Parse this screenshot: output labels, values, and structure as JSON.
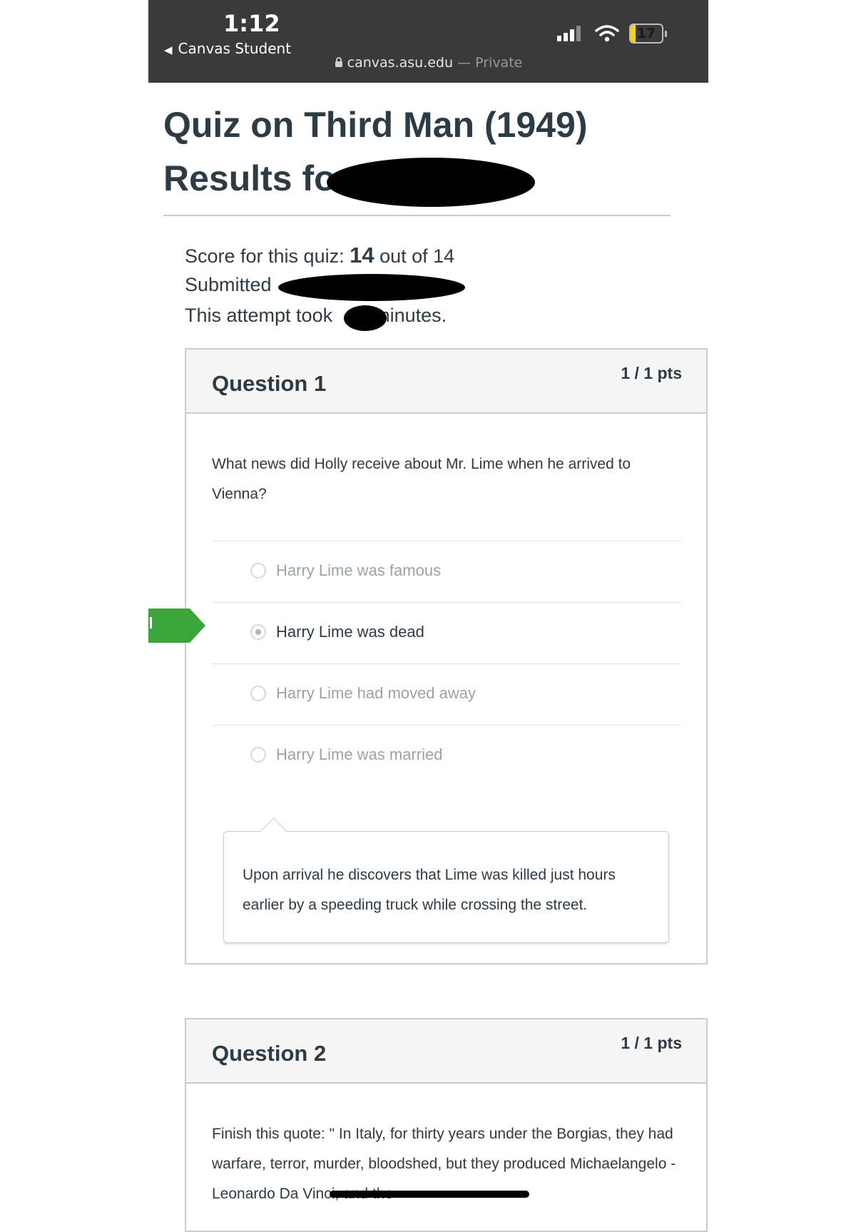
{
  "status_bar": {
    "time": "1:12",
    "back_app": "Canvas Student",
    "url": "canvas.asu.edu",
    "private_label": "— Private",
    "battery_level": "17",
    "battery_fraction": 0.17,
    "signal_icon": "cellular-signal-icon",
    "wifi_icon": "wifi-icon",
    "lock_icon": "lock-icon"
  },
  "page": {
    "title": "Quiz on Third Man (1949)",
    "results_prefix": "Results fo"
  },
  "summary": {
    "score_prefix": "Score for this quiz: ",
    "score": "14",
    "score_suffix": " out of 14",
    "submitted_label": "Submitted",
    "attempt_prefix": "This attempt took",
    "attempt_suffix": "minutes."
  },
  "questions": [
    {
      "name": "Question 1",
      "points": "1 / 1 pts",
      "text": "What news did Holly receive about Mr. Lime when he arrived to Vienna?",
      "answers": [
        {
          "label": "Harry Lime was famous",
          "selected": false
        },
        {
          "label": "Harry Lime was dead",
          "selected": true
        },
        {
          "label": "Harry Lime had moved away",
          "selected": false
        },
        {
          "label": "Harry Lime was married",
          "selected": false
        }
      ],
      "comment": "Upon arrival he discovers that Lime was killed just hours earlier by a speeding truck while crossing the street."
    },
    {
      "name": "Question 2",
      "points": "1 / 1 pts",
      "text": "Finish this quote: \" In Italy, for thirty years under the Borgias, they had warfare, terror, murder, bloodshed, but they produced Michaelangelo - Leonardo Da Vinci, and the"
    }
  ],
  "colors": {
    "status_bar_bg": "#3a3a3a",
    "battery_fill": "#f2d21b",
    "correct_flag": "#3aa53a",
    "heading_text": "#2d3b45",
    "card_border": "#c7cdd1"
  }
}
